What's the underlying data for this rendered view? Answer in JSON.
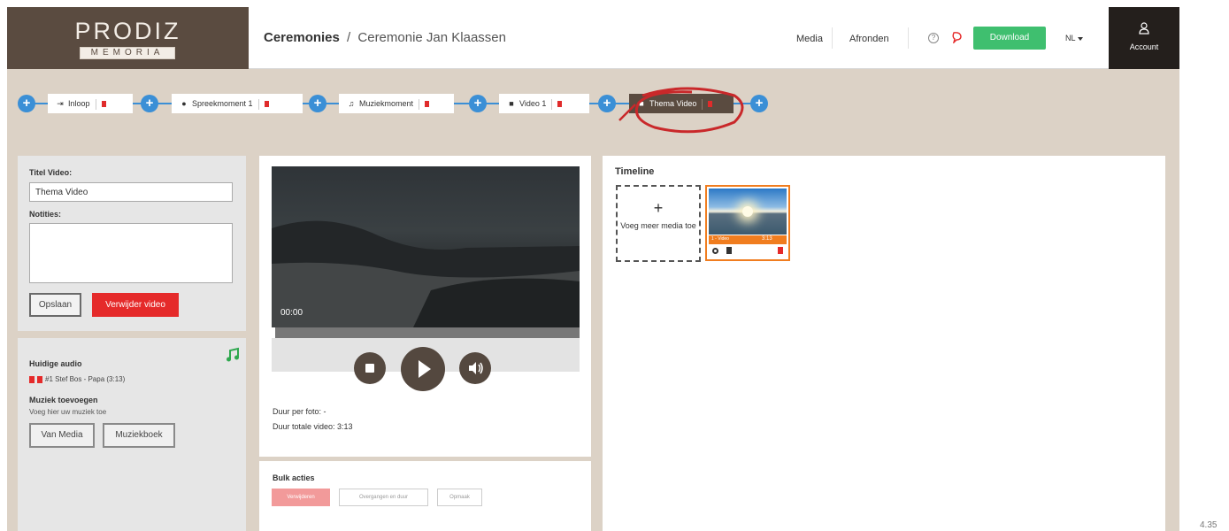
{
  "logo": {
    "main": "PRODIZ",
    "sub": "MEMORIA"
  },
  "breadcrumb": {
    "root": "Ceremonies",
    "separator": "/",
    "current": "Ceremonie Jan Klaassen"
  },
  "header": {
    "media": "Media",
    "finish": "Afronden",
    "download": "Download",
    "language": "NL",
    "account": "Account",
    "icons": [
      "help-icon",
      "speech-bubble-icon",
      "user-icon"
    ]
  },
  "steps": [
    {
      "label": "Inloop",
      "icon": "sign-in-icon"
    },
    {
      "label": "Spreekmoment 1",
      "icon": "person-icon"
    },
    {
      "label": "Muziekmoment",
      "icon": "music-icon"
    },
    {
      "label": "Video 1",
      "icon": "video-icon"
    },
    {
      "label": "Thema Video",
      "icon": "video-icon",
      "active": true
    }
  ],
  "video_form": {
    "title_label": "Titel Video:",
    "title_value": "Thema Video",
    "notes_label": "Notities:",
    "notes_value": "",
    "save": "Opslaan",
    "delete": "Verwijder video"
  },
  "audio": {
    "heading": "Huidige audio",
    "track": "#1 Stef Bos - Papa (3:13)",
    "add_heading": "Muziek toevoegen",
    "add_hint": "Voeg hier uw muziek toe",
    "from_media": "Van Media",
    "music_book": "Muziekboek"
  },
  "player": {
    "timecode": "00:00",
    "progress": 0,
    "duration_per_photo": "Duur per foto: -",
    "duration_total": "Duur totale video: 3:13"
  },
  "bulk": {
    "heading": "Bulk acties",
    "delete": "Verwijderen",
    "transitions": "Overgangen en duur",
    "layout": "Opmaak"
  },
  "timeline": {
    "title": "Timeline",
    "add_plus": "+",
    "add_label": "Voeg meer media toe",
    "items": [
      {
        "label": "1 - Video",
        "duration": "3:13"
      }
    ]
  },
  "colors": {
    "brand_brown": "#5a4b40",
    "accent_blue": "#3b8fd6",
    "danger_red": "#e52a2a",
    "success_green": "#3fbf6f",
    "timeline_orange": "#f07d1f"
  },
  "page_number": "4.35"
}
